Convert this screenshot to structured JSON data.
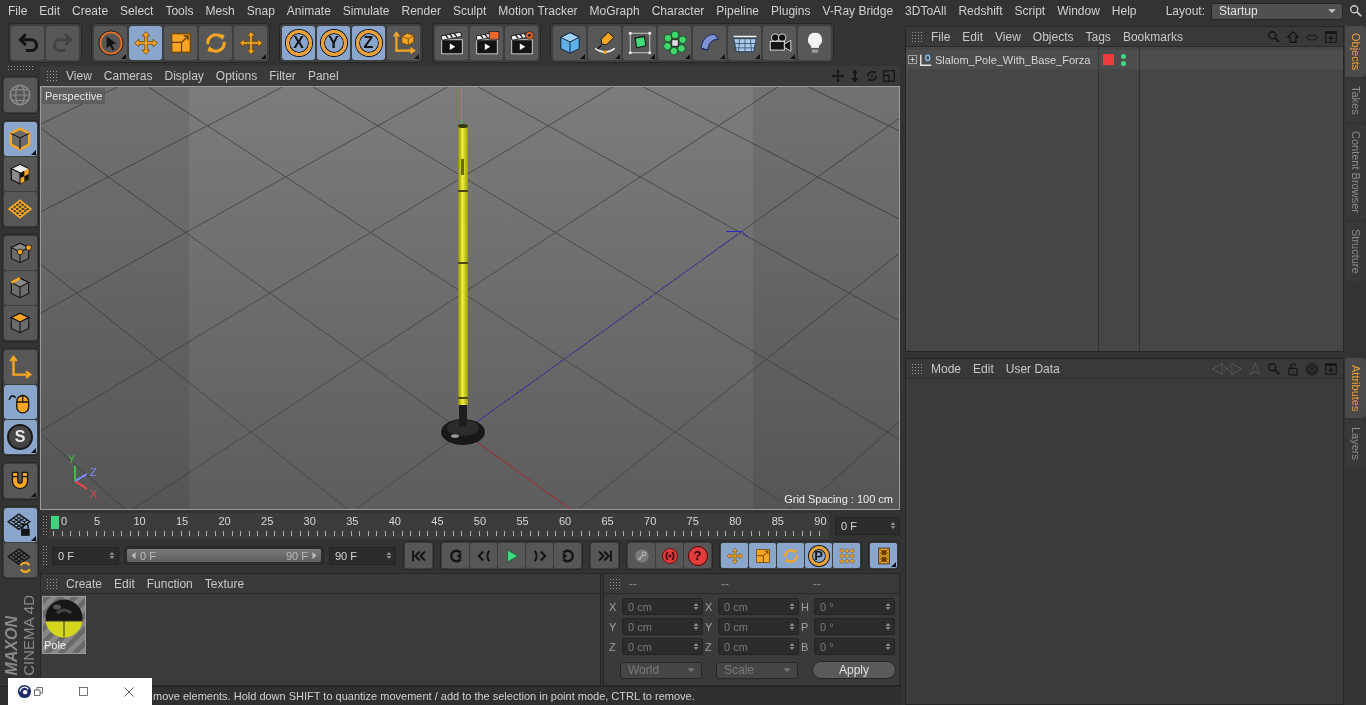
{
  "menu_bar": {
    "items": [
      "File",
      "Edit",
      "Create",
      "Select",
      "Tools",
      "Mesh",
      "Snap",
      "Animate",
      "Simulate",
      "Render",
      "Sculpt",
      "Motion Tracker",
      "MoGraph",
      "Character",
      "Pipeline",
      "Plugins",
      "V-Ray Bridge",
      "3DToAll",
      "Redshift",
      "Script",
      "Window",
      "Help"
    ],
    "layout_label": "Layout:",
    "layout_value": "Startup"
  },
  "toolbar": {
    "groups": [
      [
        {
          "kind": "undo",
          "selected": false,
          "disabled": false
        },
        {
          "kind": "redo",
          "selected": false,
          "disabled": true
        }
      ],
      [
        {
          "kind": "pointer",
          "selected": false,
          "disabled": false
        },
        {
          "kind": "move",
          "selected": true,
          "disabled": false
        },
        {
          "kind": "scale",
          "selected": false,
          "disabled": false
        },
        {
          "kind": "rotate",
          "selected": false,
          "disabled": false
        },
        {
          "kind": "transform",
          "selected": false,
          "disabled": false
        }
      ],
      [
        {
          "kind": "xaxis",
          "label": "X",
          "selected": true,
          "disabled": false
        },
        {
          "kind": "yaxis",
          "label": "Y",
          "selected": true,
          "disabled": false
        },
        {
          "kind": "zaxis",
          "label": "Z",
          "selected": true,
          "disabled": false
        },
        {
          "kind": "coords",
          "selected": false,
          "disabled": false
        }
      ],
      [
        {
          "kind": "renderview",
          "selected": false,
          "disabled": false
        },
        {
          "kind": "renderpicture",
          "selected": false,
          "disabled": false
        },
        {
          "kind": "rendersettings",
          "selected": false,
          "disabled": false
        }
      ],
      [
        {
          "kind": "cube",
          "selected": false,
          "disabled": false
        },
        {
          "kind": "pen",
          "selected": false,
          "disabled": false
        },
        {
          "kind": "subdivision",
          "selected": false,
          "disabled": false
        },
        {
          "kind": "cloner",
          "selected": false,
          "disabled": false
        },
        {
          "kind": "deformer",
          "selected": false,
          "disabled": false
        },
        {
          "kind": "floor",
          "selected": false,
          "disabled": false
        },
        {
          "kind": "camera",
          "selected": false,
          "disabled": false
        },
        {
          "kind": "light",
          "selected": false,
          "disabled": false
        }
      ]
    ]
  },
  "tool_strip": {
    "groups": [
      [
        {
          "kind": "viewmode",
          "selected": false
        }
      ],
      [
        {
          "kind": "model",
          "selected": true
        },
        {
          "kind": "texture",
          "selected": false
        },
        {
          "kind": "workplane",
          "selected": false
        }
      ],
      [
        {
          "kind": "points",
          "selected": false
        },
        {
          "kind": "edges",
          "selected": false
        },
        {
          "kind": "polygons",
          "selected": false
        }
      ],
      [
        {
          "kind": "axis",
          "selected": false
        },
        {
          "kind": "tweak",
          "selected": true
        },
        {
          "kind": "solo",
          "label": "S",
          "selected": true
        }
      ],
      [
        {
          "kind": "snap",
          "selected": false
        }
      ],
      [
        {
          "kind": "lockplane",
          "selected": true
        },
        {
          "kind": "planar",
          "selected": false
        }
      ]
    ]
  },
  "branding": {
    "company": "MAXON",
    "product": "CINEMA 4D"
  },
  "viewport": {
    "menu": [
      "View",
      "Cameras",
      "Display",
      "Options",
      "Filter",
      "Panel"
    ],
    "camera": "Perspective",
    "grid_spacing": "Grid Spacing : 100 cm",
    "axis_gizmo": [
      {
        "label": "X",
        "color": "#e04848"
      },
      {
        "label": "Y",
        "color": "#40c040"
      },
      {
        "label": "Z",
        "color": "#7888ff"
      }
    ]
  },
  "timeline": {
    "ticks": [
      "0",
      "5",
      "10",
      "15",
      "20",
      "25",
      "30",
      "35",
      "40",
      "45",
      "50",
      "55",
      "60",
      "65",
      "70",
      "75",
      "80",
      "85",
      "90"
    ],
    "level": 0,
    "current_frame": "0 F"
  },
  "transport": {
    "start_frame": "0 F",
    "range_start": "0 F",
    "range_end": "90 F",
    "level": 1,
    "end_frame": "90 F",
    "groups": [
      [
        {
          "kind": "tostart",
          "selected": false
        }
      ],
      [
        {
          "kind": "prevkey",
          "selected": false
        },
        {
          "kind": "stepback",
          "selected": false
        },
        {
          "kind": "play",
          "selected": false
        },
        {
          "kind": "stepfwd",
          "selected": false
        },
        {
          "kind": "nextkey",
          "selected": false
        }
      ],
      [
        {
          "kind": "toend",
          "selected": false
        }
      ],
      [
        {
          "kind": "record",
          "selected": false
        },
        {
          "kind": "autokey",
          "selected": false
        },
        {
          "kind": "keysel",
          "label": "?",
          "selected": false
        }
      ],
      [
        {
          "kind": "keymove",
          "selected": true
        },
        {
          "kind": "keyscale",
          "selected": true
        },
        {
          "kind": "keyrotate",
          "selected": true
        },
        {
          "kind": "keyparam",
          "label": "P",
          "selected": true
        },
        {
          "kind": "keypla",
          "selected": true
        }
      ],
      [
        {
          "kind": "timeline",
          "selected": true
        }
      ]
    ]
  },
  "materials": {
    "menu": [
      "Create",
      "Edit",
      "Function",
      "Texture"
    ],
    "items": [
      {
        "name": "Pole"
      }
    ]
  },
  "coordinates": {
    "disabled": true,
    "headers": [
      "--",
      "--",
      "--"
    ],
    "rows": [
      [
        {
          "axis": "X",
          "value": "0 cm"
        },
        {
          "axis": "X",
          "value": "0 cm"
        },
        {
          "axis": "H",
          "value": "0 °"
        }
      ],
      [
        {
          "axis": "Y",
          "value": "0 cm"
        },
        {
          "axis": "Y",
          "value": "0 cm"
        },
        {
          "axis": "P",
          "value": "0 °"
        }
      ],
      [
        {
          "axis": "Z",
          "value": "0 cm"
        },
        {
          "axis": "Z",
          "value": "0 cm"
        },
        {
          "axis": "B",
          "value": "0 °"
        }
      ]
    ],
    "space": "World",
    "mode": "Scale",
    "apply": "Apply"
  },
  "status_bar": {
    "text": "move elements. Hold down SHIFT to quantize movement / add to the selection in point mode, CTRL to remove."
  },
  "object_manager": {
    "menu": [
      "File",
      "Edit",
      "View",
      "Objects",
      "Tags",
      "Bookmarks"
    ],
    "objects": [
      {
        "name": "Slalom_Pole_With_Base_Forza",
        "expanded": false,
        "selected": false,
        "color": "#ee3b3b",
        "editor_visible": true,
        "render_visible": true
      }
    ]
  },
  "object_tabs": [
    {
      "label": "Objects",
      "selected": true
    },
    {
      "label": "Takes",
      "selected": false
    },
    {
      "label": "Content Browser",
      "selected": false
    },
    {
      "label": "Structure",
      "selected": false
    }
  ],
  "attribute_manager": {
    "menu": [
      "Mode",
      "Edit",
      "User Data"
    ]
  },
  "attribute_tabs": [
    {
      "label": "Attributes",
      "selected": true
    },
    {
      "label": "Layers",
      "selected": false
    }
  ]
}
